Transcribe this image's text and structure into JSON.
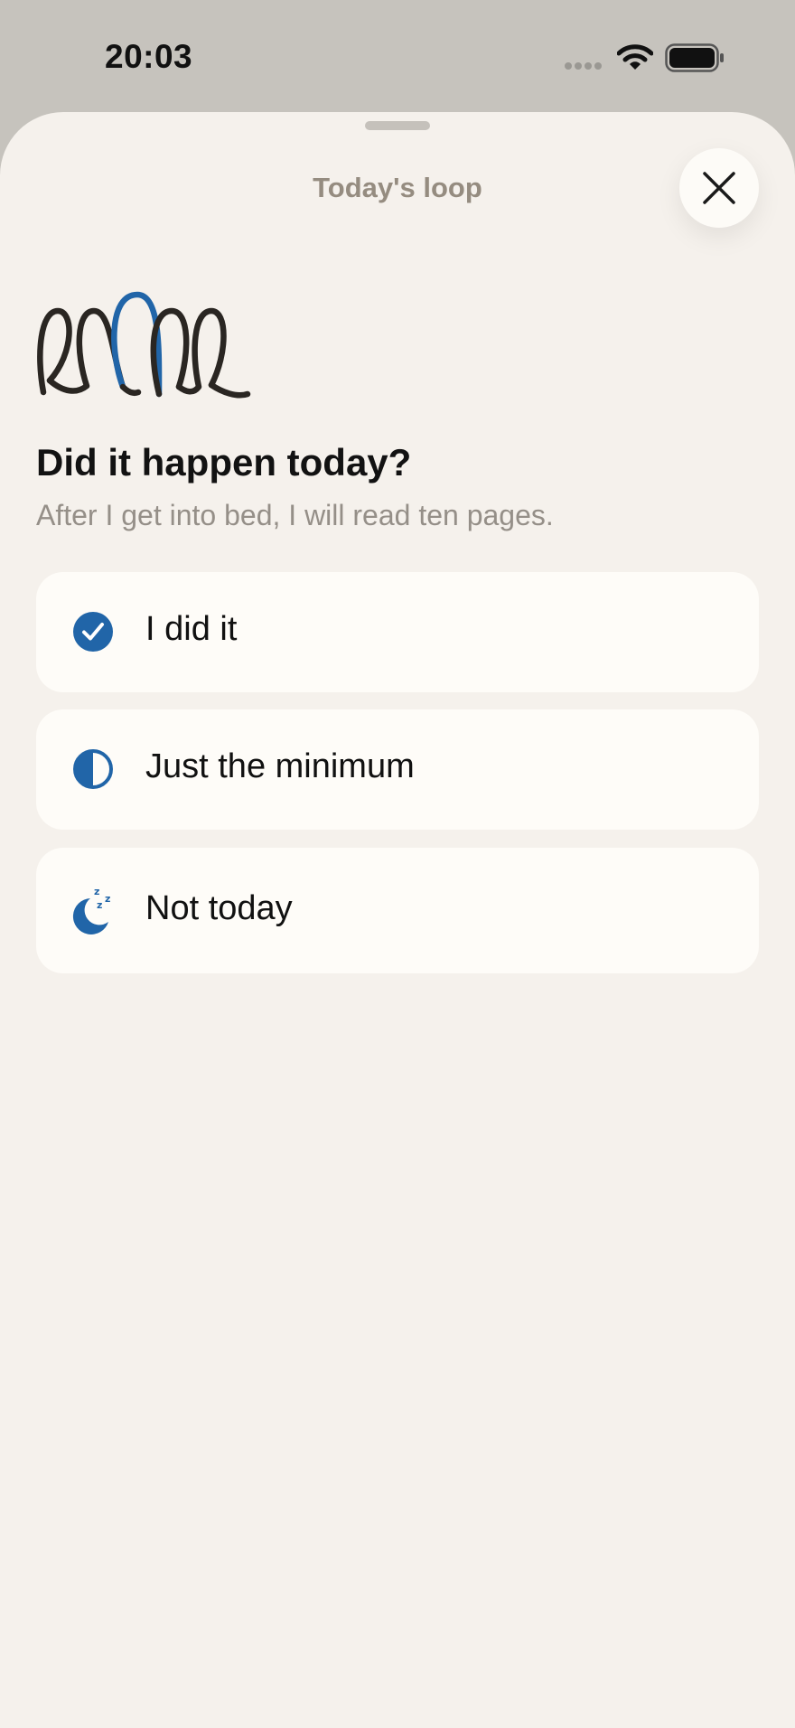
{
  "status_bar": {
    "time": "20:03"
  },
  "icons": {
    "signal": "cellular-signal-icon",
    "wifi": "wifi-icon",
    "battery": "battery-icon",
    "close": "close-icon",
    "loop": "loop-illustration"
  },
  "colors": {
    "accent": "#2165a8",
    "ink": "#2a2622",
    "sheet_background": "#f5f1ec",
    "card_background": "#fefcf8",
    "title_text": "#958c80",
    "secondary_text": "#958f88"
  },
  "sheet": {
    "title": "Today's loop",
    "question": "Did it happen today?",
    "habit": "After I get into bed, I will read ten pages."
  },
  "options": [
    {
      "label": "I did it",
      "icon": "checkmark-circle-icon"
    },
    {
      "label": "Just the minimum",
      "icon": "half-circle-icon"
    },
    {
      "label": "Not today",
      "icon": "moon-zzz-icon"
    }
  ]
}
